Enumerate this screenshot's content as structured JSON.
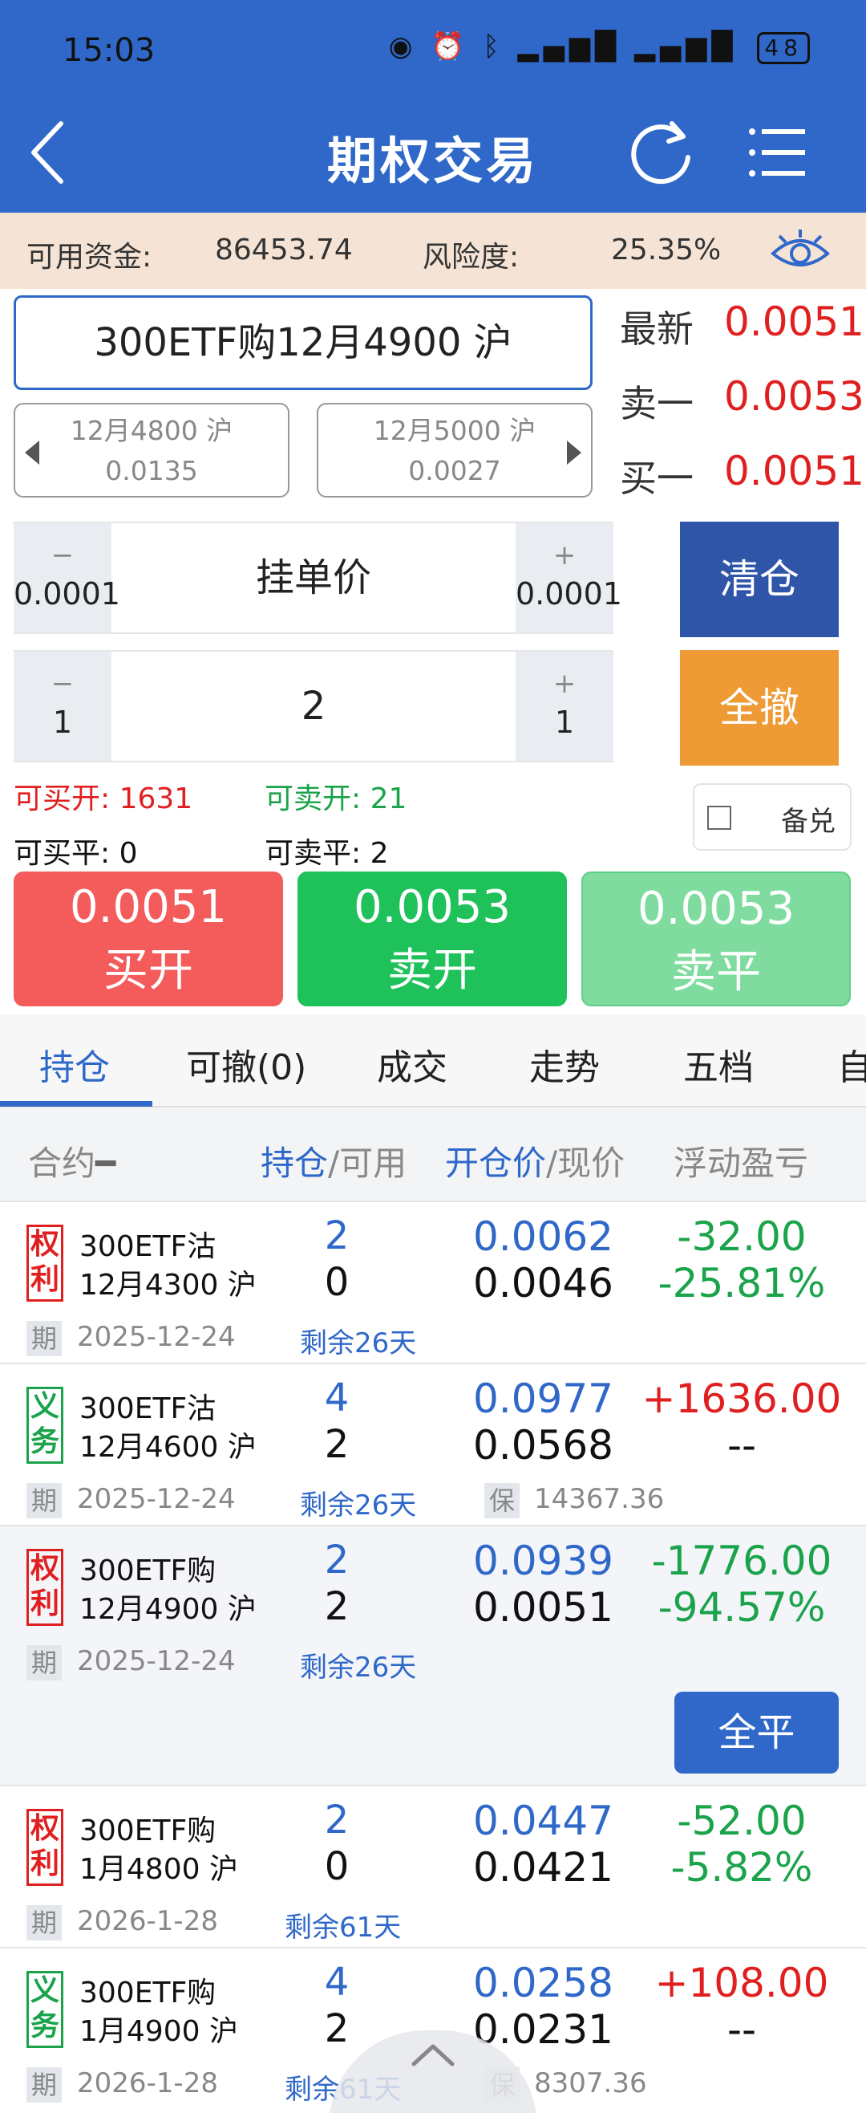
{
  "status_bar": {
    "time": "15:03",
    "battery": "48"
  },
  "header": {
    "title": "期权交易"
  },
  "account": {
    "available_label": "可用资金:",
    "available_value": "86453.74",
    "risk_label": "风险度:",
    "risk_value": "25.35%"
  },
  "contract": {
    "name": "300ETF购12月4900 沪",
    "prev": {
      "name": "12月4800 沪",
      "price": "0.0135"
    },
    "next": {
      "name": "12月5000 沪",
      "price": "0.0027"
    }
  },
  "quotes": [
    {
      "label": "最新",
      "value": "0.0051"
    },
    {
      "label": "卖一",
      "value": "0.0053"
    },
    {
      "label": "买一",
      "value": "0.0051"
    }
  ],
  "price_stepper": {
    "minus_sym": "−",
    "minus_step": "0.0001",
    "label": "挂单价",
    "plus_sym": "+",
    "plus_step": "0.0001"
  },
  "qty_stepper": {
    "minus_sym": "−",
    "minus_step": "1",
    "value": "2",
    "plus_sym": "+",
    "plus_step": "1"
  },
  "side_buttons": {
    "clear": "清仓",
    "cancel_all": "全撤"
  },
  "availability": {
    "buy_open": "可买开: 1631",
    "sell_open": "可卖开: 21",
    "buy_close": "可买平: 0",
    "sell_close": "可卖平: 2",
    "covered": "备兑"
  },
  "actions": [
    {
      "price": "0.0051",
      "label": "买开",
      "color": "#f45b5b"
    },
    {
      "price": "0.0053",
      "label": "卖开",
      "color": "#1ec15a"
    },
    {
      "price": "0.0053",
      "label": "卖平",
      "color": "#7fdc9e"
    }
  ],
  "tabs": [
    "持仓",
    "可撤(0)",
    "成交",
    "走势",
    "五档",
    "自"
  ],
  "list_header": {
    "contract": "合约",
    "pos": "持仓",
    "avail": "/可用",
    "open_price": "开仓价",
    "cur_price": "/现价",
    "pnl": "浮动盈亏"
  },
  "positions": [
    {
      "badge": [
        "权",
        "利"
      ],
      "badge_type": "right",
      "name1": "300ETF沽",
      "name2": "12月4300 沪",
      "qty": "2",
      "avail": "0",
      "open_price": "0.0062",
      "cur_price": "0.0046",
      "pnl": "-32.00",
      "pnl_pct": "-25.81%",
      "pnl_color": "green",
      "pct_color": "green",
      "date": "2025-12-24",
      "remain": "剩余26天",
      "margin": ""
    },
    {
      "badge": [
        "义",
        "务"
      ],
      "badge_type": "obligation",
      "name1": "300ETF沽",
      "name2": "12月4600 沪",
      "qty": "4",
      "avail": "2",
      "open_price": "0.0977",
      "cur_price": "0.0568",
      "pnl": "+1636.00",
      "pnl_pct": "--",
      "pnl_color": "red",
      "pct_color": "dark",
      "date": "2025-12-24",
      "remain": "剩余26天",
      "margin": "14367.36"
    },
    {
      "badge": [
        "权",
        "利"
      ],
      "badge_type": "right",
      "name1": "300ETF购",
      "name2": "12月4900 沪",
      "qty": "2",
      "avail": "2",
      "open_price": "0.0939",
      "cur_price": "0.0051",
      "pnl": "-1776.00",
      "pnl_pct": "-94.57%",
      "pnl_color": "green",
      "pct_color": "green",
      "date": "2025-12-24",
      "remain": "剩余26天",
      "margin": ""
    },
    {
      "badge": [
        "权",
        "利"
      ],
      "badge_type": "right",
      "name1": "300ETF购",
      "name2": "1月4800 沪",
      "qty": "2",
      "avail": "0",
      "open_price": "0.0447",
      "cur_price": "0.0421",
      "pnl": "-52.00",
      "pnl_pct": "-5.82%",
      "pnl_color": "green",
      "pct_color": "green",
      "date": "2026-1-28",
      "remain": "剩余61天",
      "margin": ""
    },
    {
      "badge": [
        "义",
        "务"
      ],
      "badge_type": "obligation",
      "name1": "300ETF购",
      "name2": "1月4900 沪",
      "qty": "4",
      "avail": "2",
      "open_price": "0.0258",
      "cur_price": "0.0231",
      "pnl": "+108.00",
      "pnl_pct": "--",
      "pnl_color": "red",
      "pct_color": "dark",
      "date": "2026-1-28",
      "remain": "剩余61天",
      "margin": "8307.36"
    }
  ],
  "row_labels": {
    "expiry_tag": "期",
    "margin_tag": "保"
  },
  "close_all_label": "全平"
}
